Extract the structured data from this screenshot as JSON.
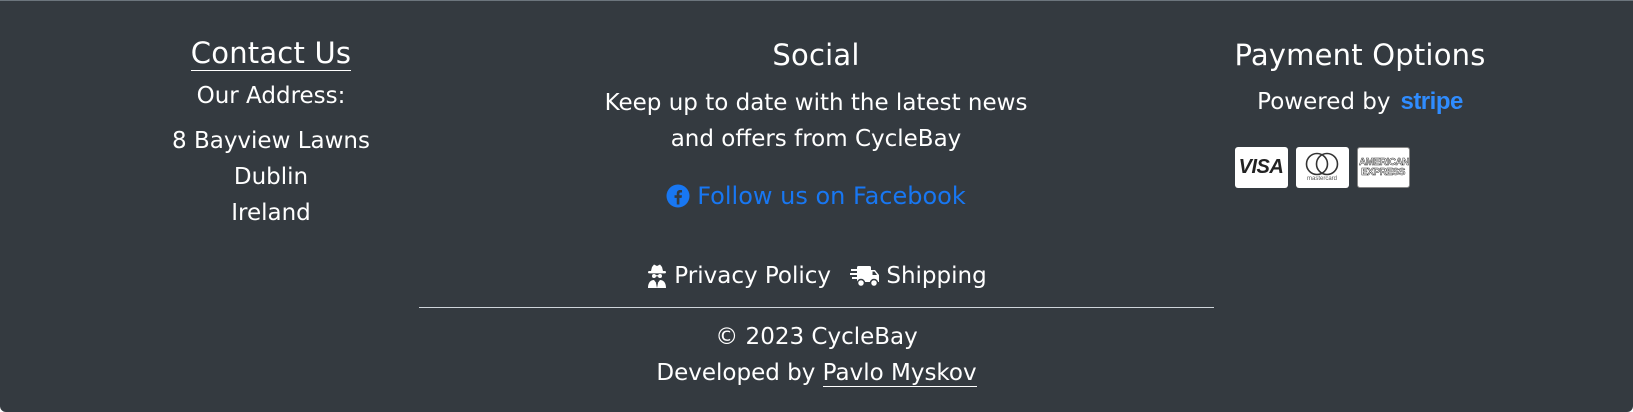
{
  "contact": {
    "heading": "Contact Us",
    "address_label": "Our Address:",
    "address_lines": [
      "8 Bayview Lawns",
      "Dublin",
      "Ireland"
    ]
  },
  "social": {
    "heading": "Social",
    "text": "Keep up to date with the latest news and offers from CycleBay",
    "facebook_label": "Follow us on Facebook",
    "facebook_icon": "facebook-icon"
  },
  "payment": {
    "heading": "Payment Options",
    "powered_by": "Powered by",
    "provider": "stripe",
    "cards": [
      {
        "name": "VISA",
        "icon": "visa-card-icon"
      },
      {
        "name": "mastercard",
        "icon": "mastercard-icon"
      },
      {
        "name": "AMERICAN EXPRESS",
        "icon": "amex-card-icon"
      }
    ]
  },
  "footer_links": {
    "privacy_label": "Privacy Policy",
    "privacy_icon": "user-secret-icon",
    "shipping_label": "Shipping",
    "shipping_icon": "shipping-fast-icon"
  },
  "bottom": {
    "copyright": "© 2023 CycleBay",
    "developed_by": "Developed by",
    "developer": "Pavlo Myskov"
  },
  "colors": {
    "background": "#343a40",
    "text": "#ffffff",
    "link_accent": "#1877f2",
    "stripe_brand": "#2f8cff"
  }
}
